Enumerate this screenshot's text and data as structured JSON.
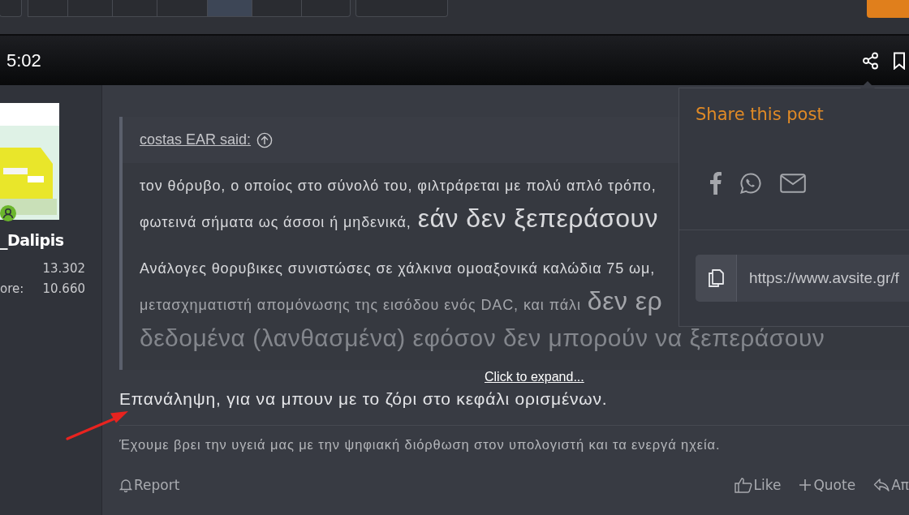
{
  "top_nav": {
    "tabs": [
      {
        "selected": false
      },
      {
        "selected": false
      },
      {
        "selected": false
      },
      {
        "selected": false
      },
      {
        "selected": false
      },
      {
        "selected": true
      },
      {
        "selected": false
      },
      {
        "selected": false
      },
      {
        "selected": false
      }
    ]
  },
  "header": {
    "time": "5:02"
  },
  "author": {
    "name": "_Dalipis",
    "online": true,
    "stats": [
      {
        "value": "13.302"
      },
      {
        "label": "ore:",
        "value": "10.660"
      }
    ]
  },
  "quote": {
    "attribution": "costas EAR said:",
    "paragraphs": [
      [
        [
          {
            "kind": "normal",
            "text": "τον θόρυβο, ο οποίος στο σύνολό του, φιλτράρεται με πολύ απλό τρόπο,"
          }
        ],
        [
          {
            "kind": "normal",
            "text": "φωτεινά σήματα ως άσσοι ή μηδενικά,"
          },
          {
            "kind": "large",
            "text": "εάν δεν ξεπεράσουν"
          }
        ]
      ],
      [
        [
          {
            "kind": "normal",
            "text": "Ανάλογες θορυβικες συνιστώσες σε χάλκινα ομοαξονικά καλώδια 75 ωμ,"
          }
        ],
        [
          {
            "kind": "normal",
            "text": "μετασχηματιστή απομόνωσης της εισόδου ενός DAC, και πάλι"
          },
          {
            "kind": "large",
            "text": "δεν ερ"
          }
        ],
        [
          {
            "kind": "huge",
            "text": "δεδομένα (λανθασμένα) εφόσον δεν μπορούν να ξεπεράσουν"
          }
        ]
      ]
    ],
    "expand_link": "Click to expand..."
  },
  "post": {
    "text": "Επανάληψη, για να μπουν με το ζόρι στο κεφάλι ορισμένων.",
    "signature": "Έχουμε βρει την υγειά μας με την ψηφιακή διόρθωση στον υπολογιστή και τα ενεργά ηχεία."
  },
  "actions": {
    "left": [
      {
        "kind": "report",
        "label": "Report"
      }
    ],
    "right": [
      {
        "kind": "like",
        "label": "Like"
      },
      {
        "kind": "quote",
        "label": "Quote"
      },
      {
        "kind": "reply",
        "label": "Απ"
      }
    ]
  },
  "share_popup": {
    "title": "Share this post",
    "networks": [
      {
        "kind": "facebook"
      },
      {
        "kind": "whatsapp"
      },
      {
        "kind": "email"
      }
    ],
    "url": "https://www.avsite.gr/f"
  }
}
